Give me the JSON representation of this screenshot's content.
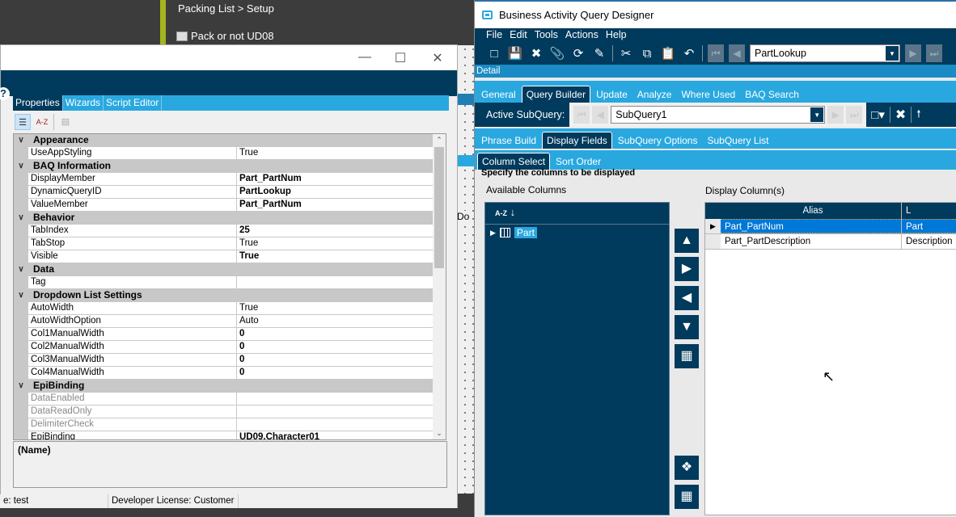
{
  "background": {
    "breadcrumb": "Packing List > Setup",
    "form_item": "Pack or not UD08",
    "designer_text": "Do"
  },
  "properties_window": {
    "tabs": [
      "Properties",
      "Wizards",
      "Script Editor"
    ],
    "help_icon": "?",
    "toolbar": {
      "categorized": "categorized-icon",
      "alphabetical": "A-Z",
      "pages": "property-pages-icon"
    },
    "rows": [
      {
        "type": "cat",
        "label": "Appearance"
      },
      {
        "k": "UseAppStyling",
        "v": "True"
      },
      {
        "type": "cat",
        "label": "BAQ Information"
      },
      {
        "k": "DisplayMember",
        "v": "Part_PartNum",
        "bold": true
      },
      {
        "k": "DynamicQueryID",
        "v": "PartLookup",
        "bold": true
      },
      {
        "k": "ValueMember",
        "v": "Part_PartNum",
        "bold": true
      },
      {
        "type": "cat",
        "label": "Behavior"
      },
      {
        "k": "TabIndex",
        "v": "25",
        "bold": true
      },
      {
        "k": "TabStop",
        "v": "True"
      },
      {
        "k": "Visible",
        "v": "True",
        "bold": true
      },
      {
        "type": "cat",
        "label": "Data"
      },
      {
        "k": "Tag",
        "v": ""
      },
      {
        "type": "cat",
        "label": "Dropdown List Settings"
      },
      {
        "k": "AutoWidth",
        "v": "True"
      },
      {
        "k": "AutoWidthOption",
        "v": "Auto"
      },
      {
        "k": "Col1ManualWidth",
        "v": "0",
        "bold": true
      },
      {
        "k": "Col2ManualWidth",
        "v": "0",
        "bold": true
      },
      {
        "k": "Col3ManualWidth",
        "v": "0",
        "bold": true
      },
      {
        "k": "Col4ManualWidth",
        "v": "0",
        "bold": true
      },
      {
        "type": "cat",
        "label": "EpiBinding"
      },
      {
        "k": "DataEnabled",
        "v": "",
        "disabled": true
      },
      {
        "k": "DataReadOnly",
        "v": "",
        "disabled": true
      },
      {
        "k": "DelimiterCheck",
        "v": "",
        "disabled": true
      },
      {
        "k": "EpiBinding",
        "v": "UD09.Character01",
        "bold": true
      }
    ],
    "description_title": "(Name)",
    "status": {
      "left": "e:  test",
      "license": "Developer License:  Customer"
    }
  },
  "baq_window": {
    "title": "Business Activity Query Designer",
    "menu": [
      "File",
      "Edit",
      "Tools",
      "Actions",
      "Help"
    ],
    "query_combo": "PartLookup",
    "detail_label": "Detail",
    "main_tabs": [
      "General",
      "Query Builder",
      "Update",
      "Analyze",
      "Where Used",
      "BAQ Search"
    ],
    "active_main_tab": "Query Builder",
    "active_subquery_label": "Active SubQuery:",
    "subquery_combo": "SubQuery1",
    "sub_tabs": [
      "Phrase Build",
      "Display Fields",
      "SubQuery Options",
      "SubQuery List"
    ],
    "column_tabs": [
      "Column Select",
      "Sort Order"
    ],
    "instruction": "Specify the columns to be displayed",
    "available_label": "Available Columns",
    "display_label": "Display Column(s)",
    "sort_icon": "A-Z",
    "tree": [
      {
        "label": "Part"
      }
    ],
    "grid": {
      "columns": [
        "Alias",
        "L"
      ],
      "rows": [
        [
          "Part_PartNum",
          "Part"
        ],
        [
          "Part_PartDescription",
          "Description"
        ]
      ]
    }
  }
}
